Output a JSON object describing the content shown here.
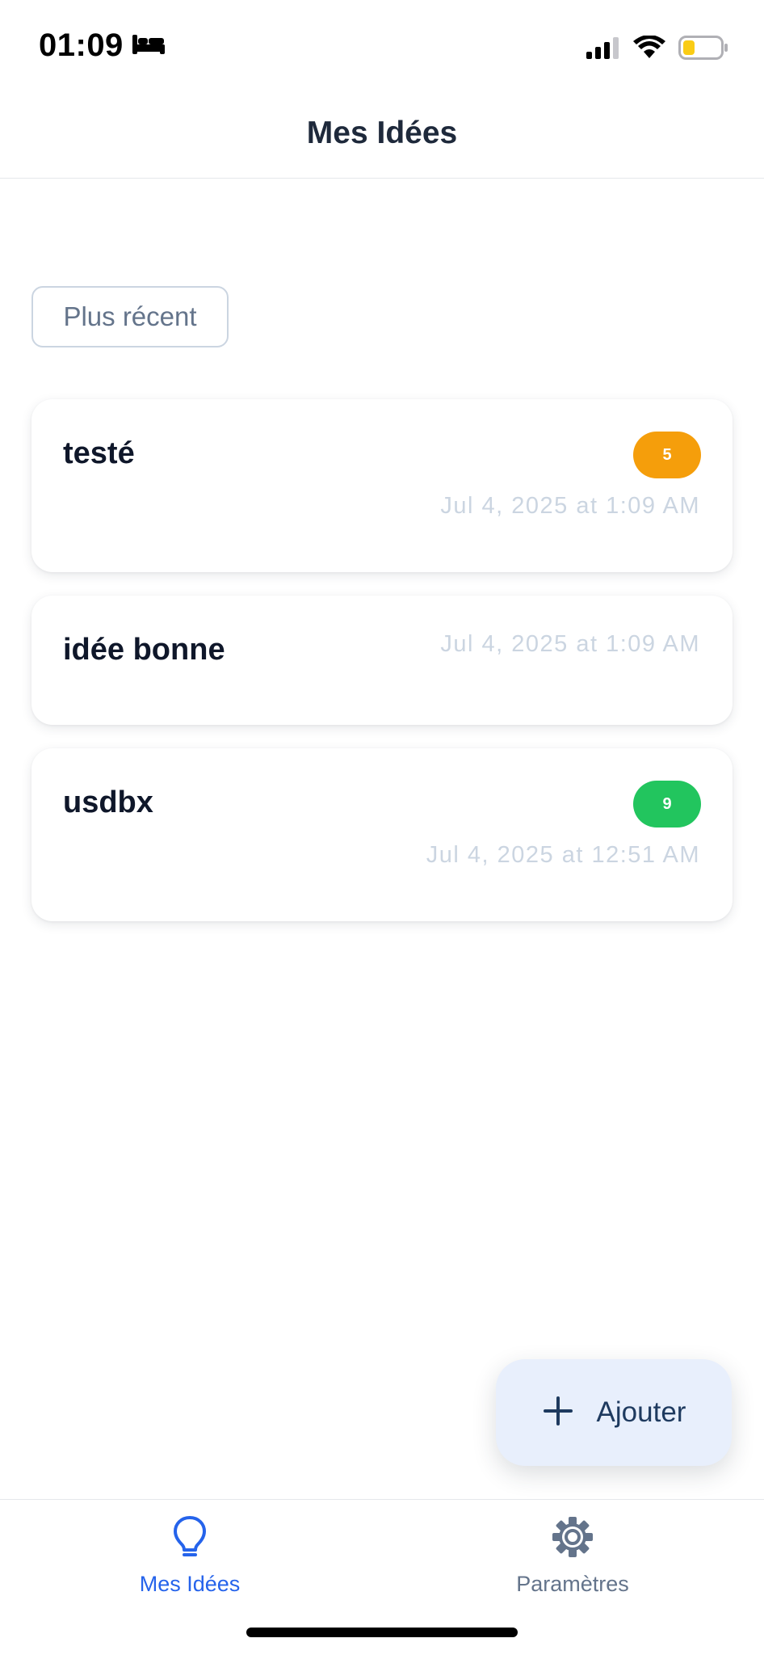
{
  "status_bar": {
    "time": "01:09",
    "sleep_icon": "bed-icon",
    "signal_icon": "cellular-signal-icon",
    "wifi_icon": "wifi-icon",
    "battery_icon": "battery-low-icon",
    "battery_color": "#facc15"
  },
  "header": {
    "title": "Mes Idées"
  },
  "sort": {
    "label": "Plus récent"
  },
  "ideas": [
    {
      "title": "testé",
      "date": "Jul 4, 2025 at 1:09 AM",
      "badge": "5",
      "badge_color": "#f59e0b"
    },
    {
      "title": "idée bonne",
      "date": "Jul 4, 2025 at 1:09 AM"
    },
    {
      "title": "usdbx",
      "date": "Jul 4, 2025 at 12:51 AM",
      "badge": "9",
      "badge_color": "#22c55e"
    }
  ],
  "fab": {
    "label": "Ajouter",
    "icon": "plus-icon"
  },
  "tabs": [
    {
      "label": "Mes Idées",
      "icon": "lightbulb-icon",
      "active": true,
      "color": "#2563eb"
    },
    {
      "label": "Paramètres",
      "icon": "gear-icon",
      "active": false,
      "color": "#64748b"
    }
  ]
}
